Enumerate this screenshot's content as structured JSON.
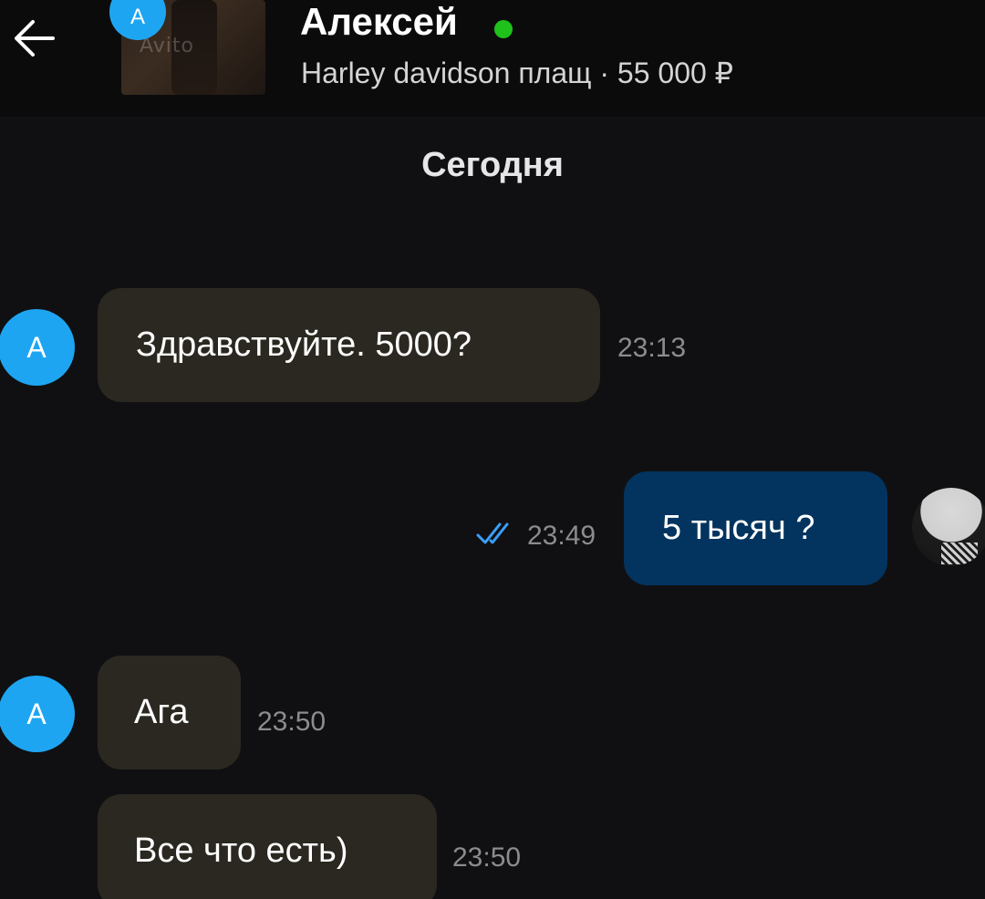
{
  "header": {
    "avatar_letter": "A",
    "thumbnail_watermark": "Avito",
    "contact_name": "Алексей",
    "online": true,
    "listing_title": "Harley davidson плащ · 55 000 ₽",
    "icons": {
      "back": "arrow-left-icon",
      "online": "online-status-dot"
    }
  },
  "chat": {
    "date_divider": "Сегодня",
    "messages": [
      {
        "direction": "incoming",
        "avatar_letter": "A",
        "text": "Здравствуйте. 5000?",
        "time": "23:13"
      },
      {
        "direction": "outgoing",
        "text": "5 тысяч ?",
        "time": "23:49",
        "status": "read"
      },
      {
        "direction": "incoming",
        "avatar_letter": "A",
        "text": "Ага",
        "time": "23:50"
      },
      {
        "direction": "incoming",
        "text": "Все что есть)",
        "time": "23:50"
      }
    ]
  },
  "colors": {
    "background": "#101012",
    "incoming_bubble": "#2a2820",
    "outgoing_bubble": "#03345f",
    "avatar_blue": "#1ea5f2",
    "online_green": "#1ec21a",
    "read_ticks": "#3aa0ff"
  }
}
